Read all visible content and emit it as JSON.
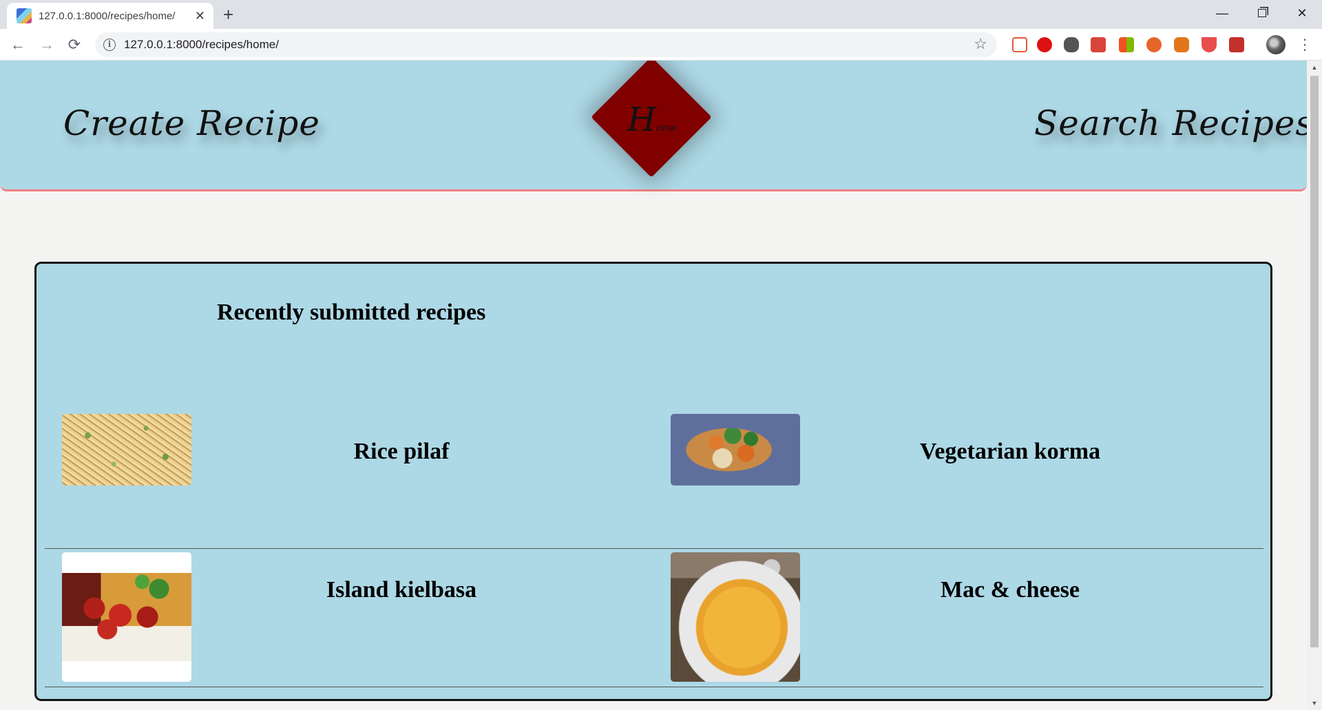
{
  "browser": {
    "tab_title": "127.0.0.1:8000/recipes/home/",
    "tab_close": "✕",
    "new_tab": "+",
    "url": "127.0.0.1:8000/recipes/home/",
    "window_min": "—",
    "window_close": "✕",
    "back": "←",
    "forward": "→",
    "reload": "⟳",
    "info": "i",
    "star": "☆",
    "menu": "⋮"
  },
  "header": {
    "create_label": "Create Recipe",
    "home_big": "H",
    "home_small": "ome",
    "search_label": "Search Recipes",
    "background_color": "#add8e6",
    "border_color": "#f08080",
    "home_color": "#800000"
  },
  "recipes": {
    "title": "Recently submitted recipes",
    "items": [
      {
        "name": "Rice pilaf",
        "image": "rice-pilaf-photo"
      },
      {
        "name": "Vegetarian korma",
        "image": "vegetarian-korma-photo"
      },
      {
        "name": "Island kielbasa",
        "image": "island-kielbasa-photo"
      },
      {
        "name": "Mac & cheese",
        "image": "mac-and-cheese-photo"
      }
    ]
  }
}
